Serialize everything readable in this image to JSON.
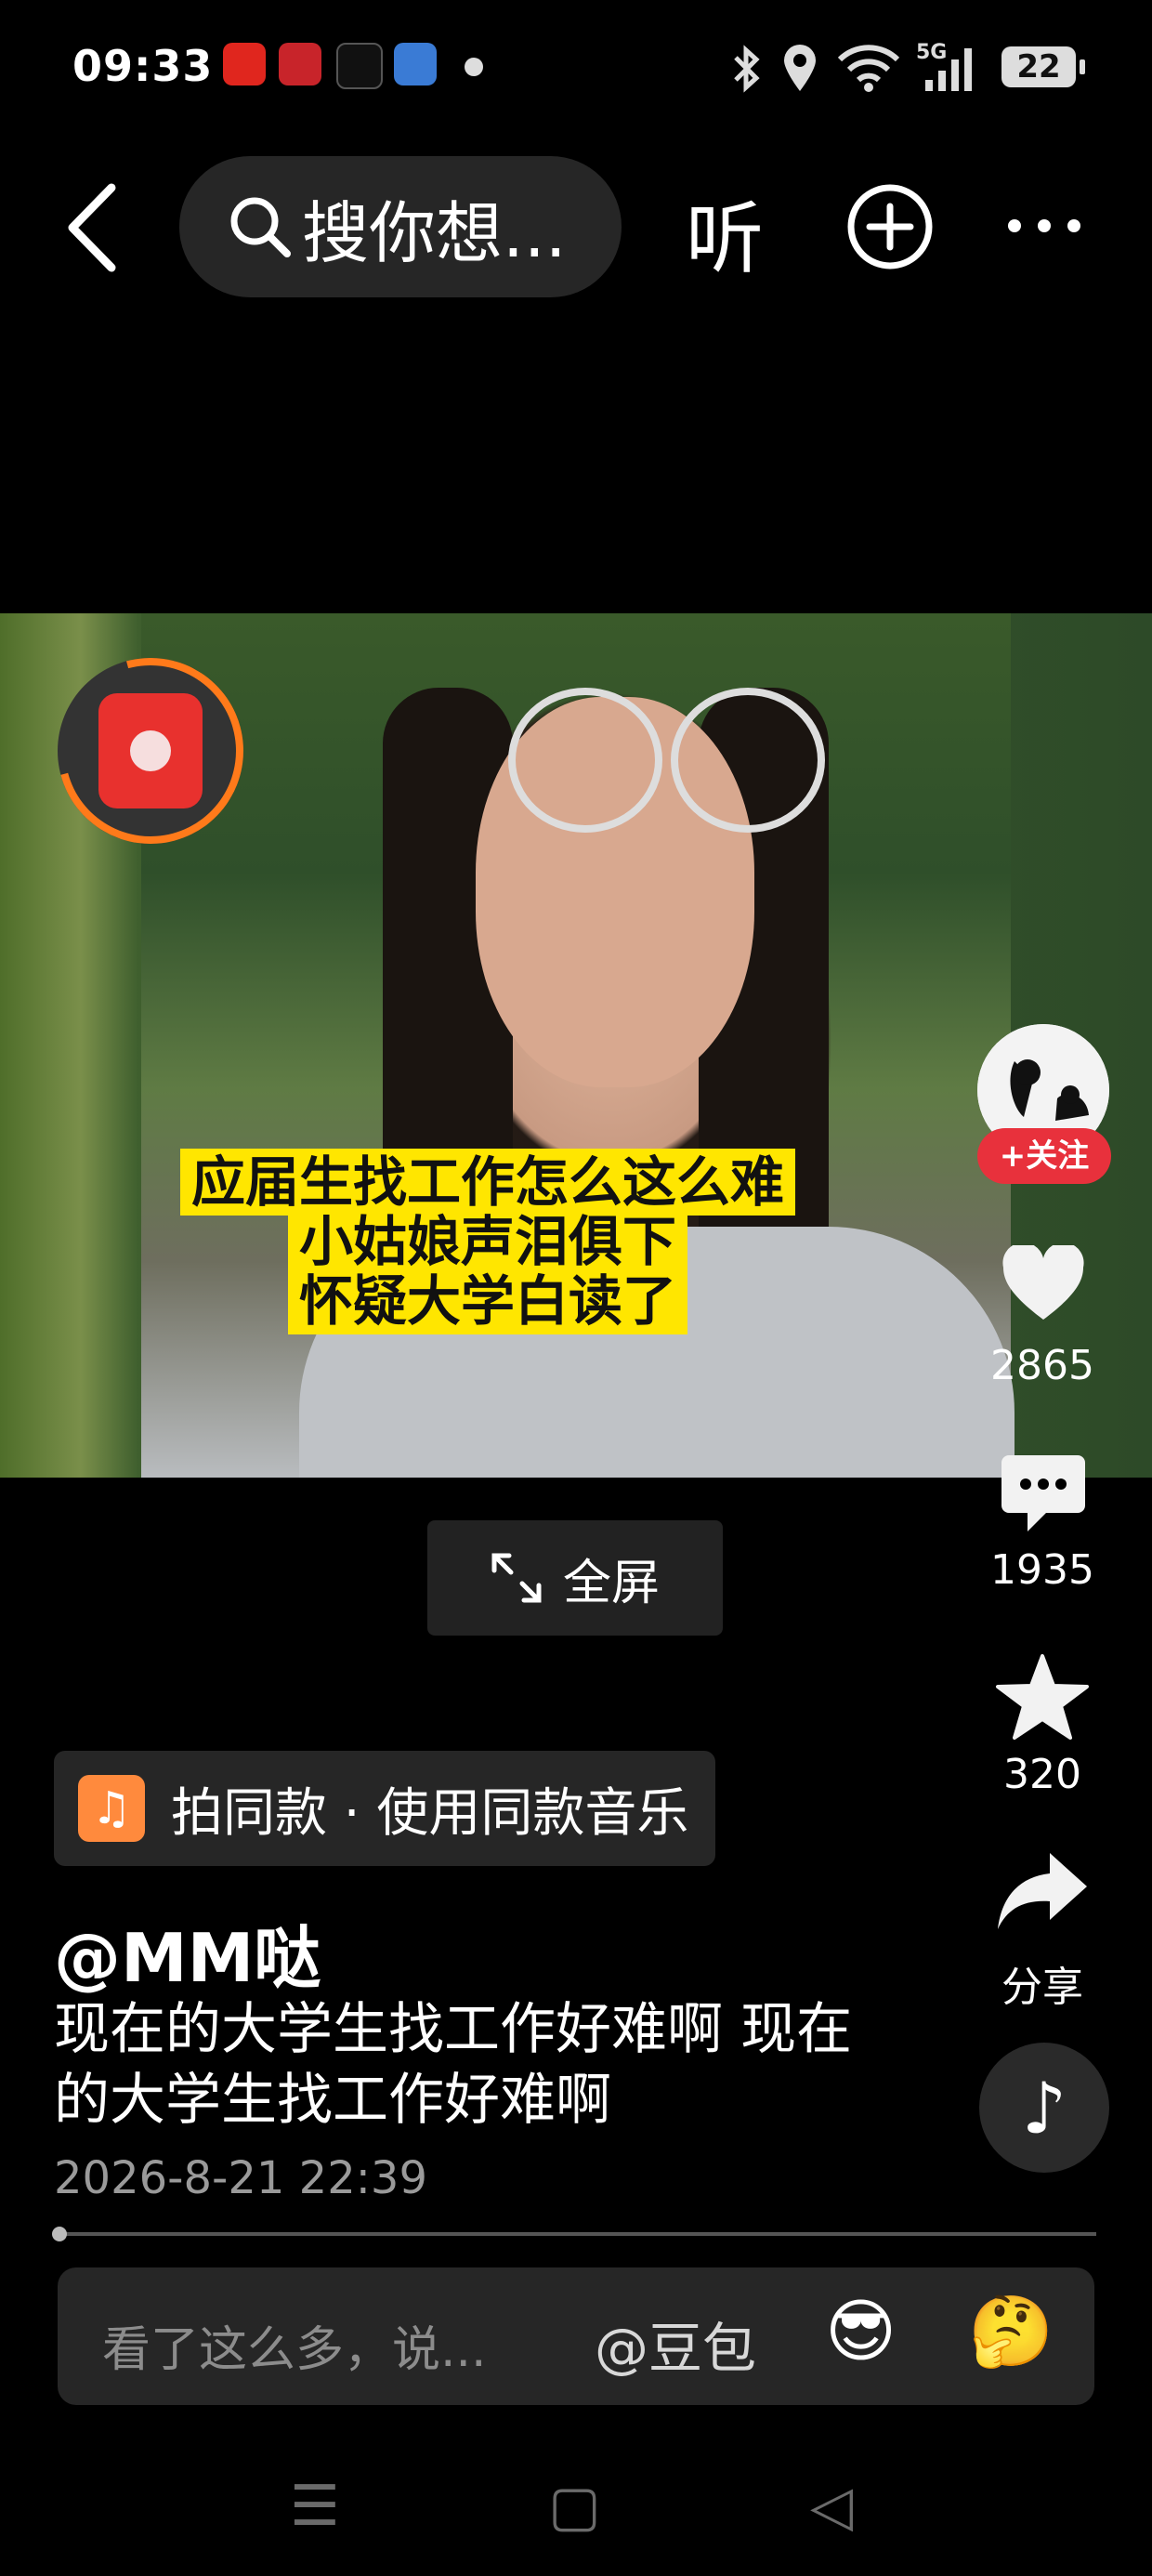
{
  "status_bar": {
    "time": "09:33",
    "battery": "22",
    "network": "5G"
  },
  "header": {
    "search_placeholder": "搜你想...",
    "listen_label": "听"
  },
  "video": {
    "caption_lines": [
      "应届生找工作怎么这么难",
      "小姑娘声泪俱下",
      "怀疑大学白读了"
    ],
    "fullscreen_label": "全屏"
  },
  "side_actions": {
    "follow_label": "+关注",
    "likes": "2865",
    "comments": "1935",
    "favorites": "320",
    "share_label": "分享"
  },
  "music": {
    "same_style_label": "拍同款 · 使用同款音乐"
  },
  "post": {
    "username": "@MM哒",
    "description": "现在的大学生找工作好难啊 现在的大学生找工作好难啊",
    "date": "2026-8-21 22:39"
  },
  "comment_bar": {
    "placeholder": "看了这么多，说...",
    "mention": "@豆包",
    "emoji1": "😎",
    "emoji2": "🤔"
  },
  "nav": {
    "menu_glyph": "☰",
    "home_glyph": "▢",
    "back_glyph": "◁"
  },
  "colors": {
    "accent_red": "#e8313c",
    "caption_yellow": "#ffe600",
    "ring_orange": "#ff7a1a"
  }
}
